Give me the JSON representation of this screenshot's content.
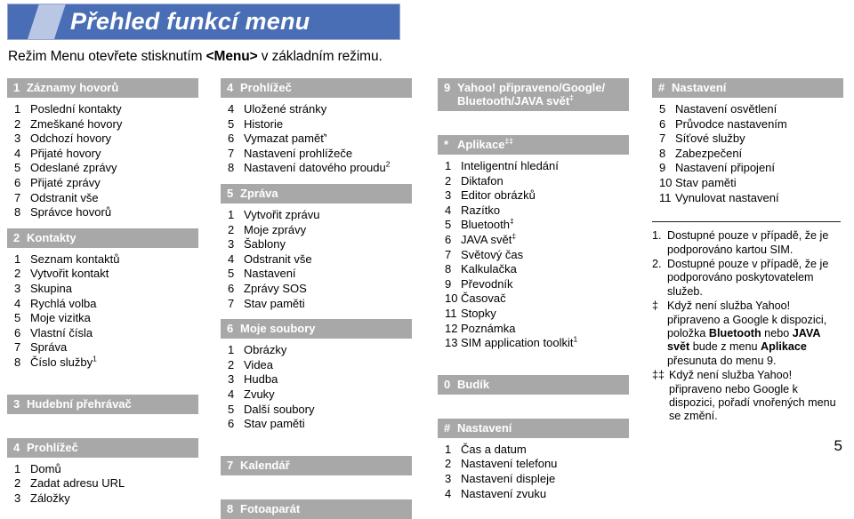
{
  "header": {
    "title": "Přehled funkcí menu",
    "banner_color": "#4a6eb5",
    "slash_color": "#b9c7e4",
    "subtitle_before": "Režim Menu otevřete stisknutím ",
    "subtitle_bold": "<Menu>",
    "subtitle_after": " v základním režimu."
  },
  "section_bar_color": "#a8a8a8",
  "columns": [
    {
      "id": "column-1",
      "sections": [
        {
          "num": "1",
          "label": "Záznamy hovorů",
          "items": [
            {
              "num": "1",
              "label": "Poslední kontakty"
            },
            {
              "num": "2",
              "label": "Zmeškané hovory"
            },
            {
              "num": "3",
              "label": "Odchozí hovory"
            },
            {
              "num": "4",
              "label": "Přijaté hovory"
            },
            {
              "num": "5",
              "label": "Odeslané zprávy"
            },
            {
              "num": "6",
              "label": "Přijaté zprávy"
            },
            {
              "num": "7",
              "label": "Odstranit vše"
            },
            {
              "num": "8",
              "label": "Správce hovorů"
            }
          ]
        },
        {
          "num": "2",
          "label": "Kontakty",
          "items": [
            {
              "num": "1",
              "label": "Seznam kontaktů"
            },
            {
              "num": "2",
              "label": "Vytvořit kontakt"
            },
            {
              "num": "3",
              "label": "Skupina"
            },
            {
              "num": "4",
              "label": "Rychlá volba"
            },
            {
              "num": "5",
              "label": "Moje vizitka"
            },
            {
              "num": "6",
              "label": "Vlastní čísla"
            },
            {
              "num": "7",
              "label": "Správa"
            },
            {
              "num": "8",
              "label": "Číslo služby",
              "sup": "1"
            }
          ]
        },
        {
          "num": "3",
          "label": "Hudební přehrávač",
          "items": []
        },
        {
          "num": "4",
          "label": "Prohlížeč",
          "items": [
            {
              "num": "1",
              "label": "Domů"
            },
            {
              "num": "2",
              "label": "Zadat adresu URL"
            },
            {
              "num": "3",
              "label": "Záložky"
            }
          ]
        }
      ]
    },
    {
      "id": "column-2",
      "sections": [
        {
          "num": "4",
          "label": "Prohlížeč",
          "items": [
            {
              "num": "4",
              "label": "Uložené stránky"
            },
            {
              "num": "5",
              "label": "Historie"
            },
            {
              "num": "6",
              "label": "Vymazat paměť'"
            },
            {
              "num": "7",
              "label": "Nastavení prohlížeče"
            },
            {
              "num": "8",
              "label": "Nastavení datového proudu",
              "sup": "2"
            }
          ]
        },
        {
          "num": "5",
          "label": "Zpráva",
          "items": [
            {
              "num": "1",
              "label": "Vytvořit zprávu"
            },
            {
              "num": "2",
              "label": "Moje zprávy"
            },
            {
              "num": "3",
              "label": "Šablony"
            },
            {
              "num": "4",
              "label": "Odstranit vše"
            },
            {
              "num": "5",
              "label": "Nastavení"
            },
            {
              "num": "6",
              "label": "Zprávy SOS"
            },
            {
              "num": "7",
              "label": "Stav paměti"
            }
          ]
        },
        {
          "num": "6",
          "label": "Moje soubory",
          "items": [
            {
              "num": "1",
              "label": "Obrázky"
            },
            {
              "num": "2",
              "label": "Videa"
            },
            {
              "num": "3",
              "label": "Hudba"
            },
            {
              "num": "4",
              "label": "Zvuky"
            },
            {
              "num": "5",
              "label": "Další soubory"
            },
            {
              "num": "6",
              "label": "Stav paměti"
            }
          ]
        },
        {
          "num": "7",
          "label": "Kalendář",
          "items": []
        },
        {
          "num": "8",
          "label": "Fotoaparát",
          "items": []
        }
      ]
    },
    {
      "id": "column-3",
      "sections": [
        {
          "num": "9",
          "label": "Yahoo! připraveno/Google/ Bluetooth/JAVA svět",
          "label_sup": "‡",
          "items": []
        },
        {
          "num": "*",
          "label": "Aplikace",
          "label_sup": "‡‡",
          "items": [
            {
              "num": "1",
              "label": "Inteligentní hledání"
            },
            {
              "num": "2",
              "label": "Diktafon"
            },
            {
              "num": "3",
              "label": "Editor obrázků"
            },
            {
              "num": "4",
              "label": "Razítko"
            },
            {
              "num": "5",
              "label": "Bluetooth",
              "sup": "‡"
            },
            {
              "num": "6",
              "label": "JAVA svět",
              "sup": "‡"
            },
            {
              "num": "7",
              "label": "Světový čas"
            },
            {
              "num": "8",
              "label": "Kalkulačka"
            },
            {
              "num": "9",
              "label": "Převodník"
            },
            {
              "num": "10",
              "label": "Časovač"
            },
            {
              "num": "11",
              "label": "Stopky"
            },
            {
              "num": "12",
              "label": "Poznámka"
            },
            {
              "num": "13",
              "label": "SIM application toolkit",
              "sup": "1"
            }
          ]
        },
        {
          "num": "0",
          "label": "Budík",
          "items": []
        },
        {
          "num": "#",
          "label": "Nastavení",
          "items": [
            {
              "num": "1",
              "label": "Čas a datum"
            },
            {
              "num": "2",
              "label": "Nastavení telefonu"
            },
            {
              "num": "3",
              "label": "Nastavení displeje"
            },
            {
              "num": "4",
              "label": "Nastavení zvuku"
            }
          ]
        }
      ]
    },
    {
      "id": "column-4",
      "sections": [
        {
          "num": "#",
          "label": "Nastavení",
          "items": [
            {
              "num": "5",
              "label": "Nastavení osvětlení"
            },
            {
              "num": "6",
              "label": "Průvodce nastavením"
            },
            {
              "num": "7",
              "label": "Síťové služby"
            },
            {
              "num": "8",
              "label": "Zabezpečení"
            },
            {
              "num": "9",
              "label": "Nastavení připojení"
            },
            {
              "num": "10",
              "label": "Stav paměti"
            },
            {
              "num": "11",
              "label": "Vynulovat nastavení"
            }
          ]
        }
      ]
    }
  ],
  "footnotes": [
    {
      "marker": "1.",
      "parts": [
        {
          "text": "Dostupné pouze v případě, že je podporováno kartou SIM.",
          "bold": false
        }
      ]
    },
    {
      "marker": "2.",
      "parts": [
        {
          "text": "Dostupné pouze v případě, že je podporováno poskytovatelem služeb.",
          "bold": false
        }
      ]
    },
    {
      "marker": "‡",
      "parts": [
        {
          "text": "Když není služba Yahoo! připraveno a Google k dispozici, položka ",
          "bold": false
        },
        {
          "text": "Bluetooth",
          "bold": true
        },
        {
          "text": " nebo ",
          "bold": false
        },
        {
          "text": "JAVA svět",
          "bold": true
        },
        {
          "text": " bude z menu ",
          "bold": false
        },
        {
          "text": "Aplikace",
          "bold": true
        },
        {
          "text": " přesunuta do menu 9.",
          "bold": false
        }
      ]
    },
    {
      "marker": "‡‡",
      "parts": [
        {
          "text": "Když není služba Yahoo! připraveno nebo Google k dispozici, pořadí vnořených menu se změní.",
          "bold": false
        }
      ]
    }
  ],
  "page_number": "5"
}
